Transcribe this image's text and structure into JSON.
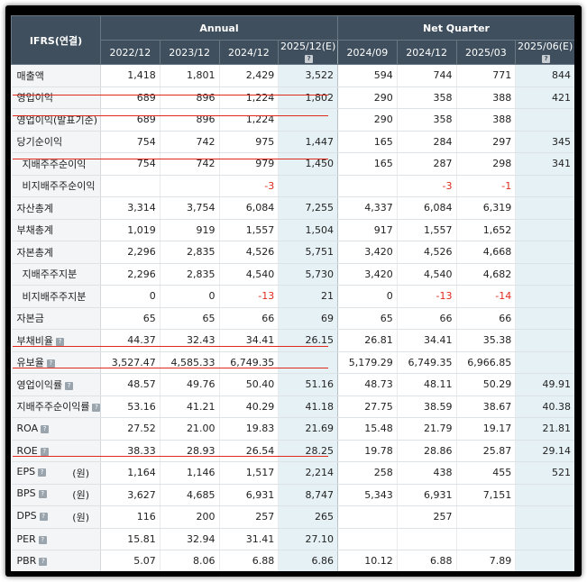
{
  "header": {
    "corner": "IFRS(연결)",
    "annual_label": "Annual",
    "quarter_label": "Net Quarter",
    "estimate_badge": "?",
    "columns": [
      {
        "label": "2022/12"
      },
      {
        "label": "2023/12"
      },
      {
        "label": "2024/12"
      },
      {
        "label": "2025/12(E)"
      },
      {
        "label": "2024/09"
      },
      {
        "label": "2024/12"
      },
      {
        "label": "2025/03"
      },
      {
        "label": "2025/06(E)"
      }
    ]
  },
  "unit_won": "(원)",
  "help_icon": "?",
  "rows": [
    {
      "label": "매출액",
      "values": [
        "1,418",
        "1,801",
        "2,429",
        "3,522",
        "594",
        "744",
        "771",
        "844"
      ]
    },
    {
      "label": "영업이익",
      "values": [
        "689",
        "896",
        "1,224",
        "1,802",
        "290",
        "358",
        "388",
        "421"
      ]
    },
    {
      "label": "영업이익(발표기준)",
      "values": [
        "689",
        "896",
        "1,224",
        "",
        "290",
        "358",
        "388",
        ""
      ]
    },
    {
      "label": "당기순이익",
      "values": [
        "754",
        "742",
        "975",
        "1,447",
        "165",
        "284",
        "297",
        "345"
      ]
    },
    {
      "label": "지배주주순이익",
      "values": [
        "754",
        "742",
        "979",
        "1,450",
        "165",
        "287",
        "298",
        "341"
      ]
    },
    {
      "label": "비지배주주순이익",
      "values": [
        "",
        "",
        "-3",
        "",
        "",
        "-3",
        "-1",
        ""
      ]
    },
    {
      "label": "자산총계",
      "values": [
        "3,314",
        "3,754",
        "6,084",
        "7,255",
        "4,337",
        "6,084",
        "6,319",
        ""
      ]
    },
    {
      "label": "부채총계",
      "values": [
        "1,019",
        "919",
        "1,557",
        "1,504",
        "917",
        "1,557",
        "1,652",
        ""
      ]
    },
    {
      "label": "자본총계",
      "values": [
        "2,296",
        "2,835",
        "4,526",
        "5,751",
        "3,420",
        "4,526",
        "4,668",
        ""
      ]
    },
    {
      "label": "지배주주지분",
      "values": [
        "2,296",
        "2,835",
        "4,540",
        "5,730",
        "3,420",
        "4,540",
        "4,682",
        ""
      ]
    },
    {
      "label": "비지배주주지분",
      "values": [
        "0",
        "0",
        "-13",
        "21",
        "0",
        "-13",
        "-14",
        ""
      ]
    },
    {
      "label": "자본금",
      "values": [
        "65",
        "65",
        "66",
        "69",
        "65",
        "66",
        "66",
        ""
      ]
    },
    {
      "label": "부채비율",
      "values": [
        "44.37",
        "32.43",
        "34.41",
        "26.15",
        "26.81",
        "34.41",
        "35.38",
        ""
      ]
    },
    {
      "label": "유보율",
      "values": [
        "3,527.47",
        "4,585.33",
        "6,749.35",
        "",
        "5,179.29",
        "6,749.35",
        "6,966.85",
        ""
      ]
    },
    {
      "label": "영업이익률",
      "values": [
        "48.57",
        "49.76",
        "50.40",
        "51.16",
        "48.73",
        "48.11",
        "50.29",
        "49.91"
      ]
    },
    {
      "label": "지배주주순이익률",
      "values": [
        "53.16",
        "41.21",
        "40.29",
        "41.18",
        "27.75",
        "38.59",
        "38.67",
        "40.38"
      ]
    },
    {
      "label": "ROA",
      "values": [
        "27.52",
        "21.00",
        "19.83",
        "21.69",
        "15.48",
        "21.79",
        "19.17",
        "21.81"
      ]
    },
    {
      "label": "ROE",
      "values": [
        "38.33",
        "28.93",
        "26.54",
        "28.25",
        "19.78",
        "28.86",
        "25.87",
        "29.14"
      ]
    },
    {
      "label": "EPS",
      "values": [
        "1,164",
        "1,146",
        "1,517",
        "2,214",
        "258",
        "438",
        "455",
        "521"
      ]
    },
    {
      "label": "BPS",
      "values": [
        "3,627",
        "4,685",
        "6,931",
        "8,747",
        "5,343",
        "6,931",
        "7,151",
        ""
      ]
    },
    {
      "label": "DPS",
      "values": [
        "116",
        "200",
        "257",
        "265",
        "",
        "257",
        "",
        ""
      ]
    },
    {
      "label": "PER",
      "values": [
        "15.81",
        "32.94",
        "31.41",
        "27.10",
        "",
        "",
        "",
        ""
      ]
    },
    {
      "label": "PBR",
      "values": [
        "5.07",
        "8.06",
        "6.88",
        "6.86",
        "10.12",
        "6.88",
        "7.89",
        ""
      ]
    }
  ],
  "colors": {
    "header_bg": "#3f4f5d",
    "estimate_col_bg": "#e6f1f6",
    "negative": "#e0291c",
    "underline": "#e0291c"
  }
}
